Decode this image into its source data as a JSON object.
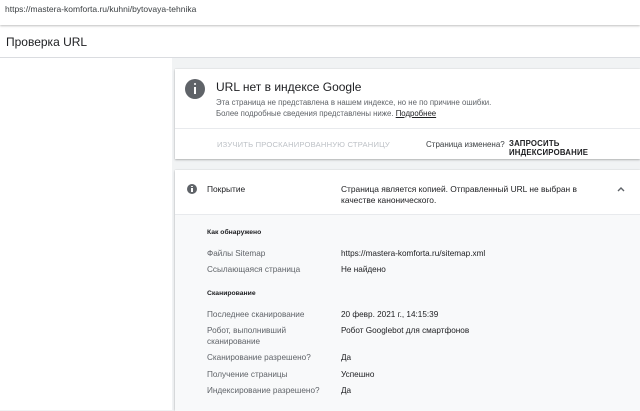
{
  "browser": {
    "url": "https://mastera-komforta.ru/kuhni/bytovaya-tehnika"
  },
  "header": {
    "title": "Проверка URL"
  },
  "status_card": {
    "title": "URL нет в индексе Google",
    "desc_line1": "Эта страница не представлена в нашем индексе, но не по причине ошибки.",
    "desc_line2": "Более подробные сведения представлены ниже.",
    "details_link": "Подробнее",
    "inspect_button": "ИЗУЧИТЬ ПРОСКАНИРОВАННУЮ СТРАНИЦУ",
    "changed_label": "Страница изменена?",
    "request_button": "ЗАПРОСИТЬ ИНДЕКСИРОВАНИЕ"
  },
  "coverage": {
    "label": "Покрытие",
    "value": "Страница является копией. Отправленный URL не выбран в качестве канонического."
  },
  "discovery": {
    "title": "Как обнаружено",
    "rows": [
      {
        "label": "Файлы Sitemap",
        "value": "https://mastera-komforta.ru/sitemap.xml"
      },
      {
        "label": "Ссылающаяся страница",
        "value": "Не найдено"
      }
    ]
  },
  "crawl": {
    "title": "Сканирование",
    "rows": [
      {
        "label": "Последнее сканирование",
        "value": "20 февр. 2021 г., 14:15:39"
      },
      {
        "label": "Робот, выполнивший сканирование",
        "value": "Робот Googlebot для смартфонов"
      },
      {
        "label": "Сканирование разрешено?",
        "value": "Да"
      },
      {
        "label": "Получение страницы",
        "value": "Успешно"
      },
      {
        "label": "Индексирование разрешено?",
        "value": "Да"
      }
    ]
  }
}
